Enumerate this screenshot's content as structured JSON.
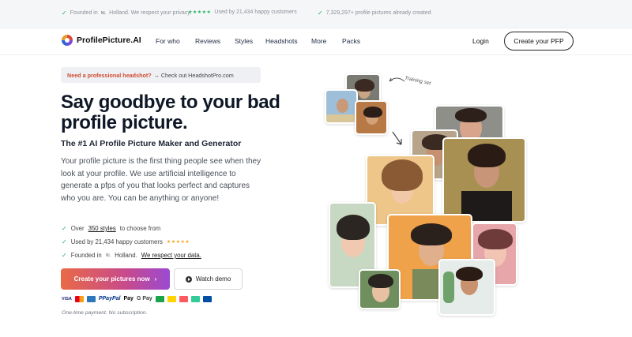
{
  "topbar": {
    "founded_text": "Founded in",
    "founded_country": "Holland. We respect your privacy.",
    "nl_flag": "NL",
    "stars": "★★★★★",
    "used_text": "Used by 21,434 happy customers",
    "created_text": "7,329,297+ profile pictures already created"
  },
  "nav": {
    "logo": "ProfilePicture.AI",
    "items": [
      "For who",
      "Reviews",
      "Styles",
      "Headshots",
      "More",
      "Packs"
    ],
    "login": "Login",
    "cta": "Create your PFP"
  },
  "promo": {
    "question": "Need a professional headshot?",
    "link": "→ Check out HeadshotPro.com"
  },
  "hero": {
    "title": "Say goodbye to your bad profile picture.",
    "subtitle": "The #1 AI Profile Picture Maker and Generator",
    "description": "Your profile picture is the first thing people see when they look at your profile. We use artificial intelligence to generate a pfps of you that looks perfect and captures who you are. You can be anything or anyone!"
  },
  "bullets": {
    "b1_pre": "Over",
    "b1_link": "350 styles",
    "b1_post": "to choose from",
    "b2": "Used by 21,434 happy customers",
    "b2_stars": "★★★★★",
    "b3_pre": "Founded in",
    "b3_flag": "NL",
    "b3_mid": "Holland.",
    "b3_link": "We respect your data."
  },
  "buttons": {
    "primary": "Create your pictures now",
    "primary_arrow": "›",
    "secondary": "Watch demo"
  },
  "payments": [
    "VISA",
    "PayPal",
    "Pay",
    "G Pay"
  ],
  "fineprint": "One-time payment. No subscription.",
  "collage": {
    "note": "Training set"
  },
  "colors": {
    "accent_start": "#e96a47",
    "accent_end": "#9b4ad2",
    "check": "#27ae60",
    "star": "#f5a623"
  }
}
